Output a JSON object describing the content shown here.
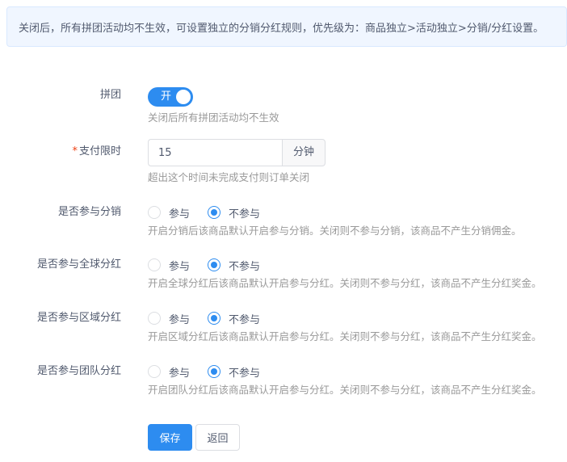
{
  "notice": "关闭后，所有拼团活动均不生效，可设置独立的分销分红规则，优先级为：商品独立>活动独立>分销/分红设置。",
  "group_buy": {
    "label": "拼团",
    "switch_text": "开",
    "enabled": true,
    "hint": "关闭后所有拼团活动均不生效"
  },
  "payment_limit": {
    "required_mark": "*",
    "label": "支付限时",
    "value": "15",
    "unit": "分钟",
    "hint": "超出这个时间未完成支付则订单关闭"
  },
  "options": {
    "join": "参与",
    "not_join": "不参与"
  },
  "distribution": {
    "label": "是否参与分销",
    "selected": "不参与",
    "hint": "开启分销后该商品默认开启参与分销。关闭则不参与分销，该商品不产生分销佣金。"
  },
  "global_dividend": {
    "label": "是否参与全球分红",
    "selected": "不参与",
    "hint": "开启全球分红后该商品默认开启参与分红。关闭则不参与分红，该商品不产生分红奖金。"
  },
  "regional_dividend": {
    "label": "是否参与区域分红",
    "selected": "不参与",
    "hint": "开启区域分红后该商品默认开启参与分红。关闭则不参与分红，该商品不产生分红奖金。"
  },
  "team_dividend": {
    "label": "是否参与团队分红",
    "selected": "不参与",
    "hint": "开启团队分红后该商品默认开启参与分红。关闭则不参与分红，该商品不产生分红奖金。"
  },
  "buttons": {
    "save": "保存",
    "back": "返回"
  },
  "colors": {
    "primary": "#2d8cf0",
    "required": "#ed4014",
    "hint": "#999999",
    "notice_bg": "#f0f6ff"
  }
}
